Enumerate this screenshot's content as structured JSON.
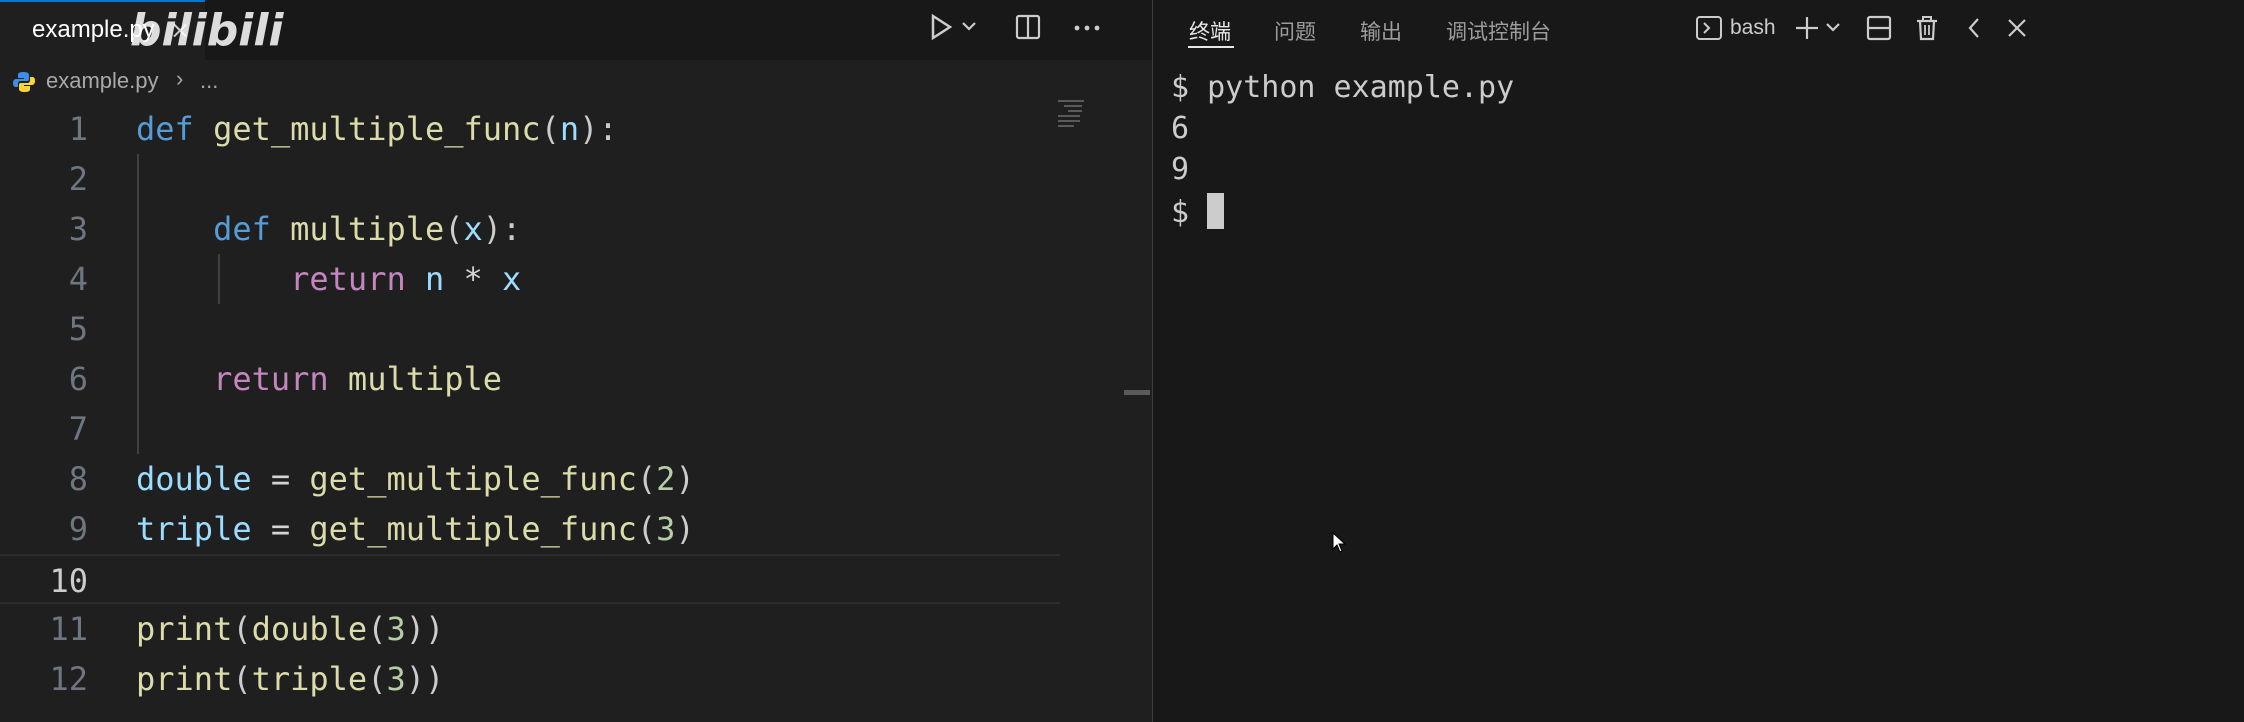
{
  "editor": {
    "tab": {
      "label": "example.py",
      "close": "×"
    },
    "watermark": "bilibili",
    "breadcrumb": {
      "file": "example.py",
      "separator": "›",
      "more": "..."
    },
    "lines": [
      {
        "num": "1",
        "tokens": [
          [
            "kw",
            "def"
          ],
          [
            "pun",
            " "
          ],
          [
            "fn",
            "get_multiple_func"
          ],
          [
            "pun",
            "("
          ],
          [
            "var",
            "n"
          ],
          [
            "pun",
            "):"
          ]
        ]
      },
      {
        "num": "2",
        "tokens": []
      },
      {
        "num": "3",
        "tokens": [
          [
            "pun",
            "    "
          ],
          [
            "kw",
            "def"
          ],
          [
            "pun",
            " "
          ],
          [
            "fn",
            "multiple"
          ],
          [
            "pun",
            "("
          ],
          [
            "var",
            "x"
          ],
          [
            "pun",
            "):"
          ]
        ]
      },
      {
        "num": "4",
        "tokens": [
          [
            "pun",
            "        "
          ],
          [
            "kw2",
            "return"
          ],
          [
            "pun",
            " "
          ],
          [
            "var",
            "n"
          ],
          [
            "op",
            " * "
          ],
          [
            "var",
            "x"
          ]
        ]
      },
      {
        "num": "5",
        "tokens": []
      },
      {
        "num": "6",
        "tokens": [
          [
            "pun",
            "    "
          ],
          [
            "kw2",
            "return"
          ],
          [
            "pun",
            " "
          ],
          [
            "fn",
            "multiple"
          ]
        ]
      },
      {
        "num": "7",
        "tokens": []
      },
      {
        "num": "8",
        "tokens": [
          [
            "var",
            "double"
          ],
          [
            "op",
            " = "
          ],
          [
            "fn",
            "get_multiple_func"
          ],
          [
            "pun",
            "("
          ],
          [
            "num",
            "2"
          ],
          [
            "pun",
            ")"
          ]
        ]
      },
      {
        "num": "9",
        "tokens": [
          [
            "var",
            "triple"
          ],
          [
            "op",
            " = "
          ],
          [
            "fn",
            "get_multiple_func"
          ],
          [
            "pun",
            "("
          ],
          [
            "num",
            "3"
          ],
          [
            "pun",
            ")"
          ]
        ]
      },
      {
        "num": "10",
        "tokens": [],
        "current": true
      },
      {
        "num": "11",
        "tokens": [
          [
            "fn",
            "print"
          ],
          [
            "pun",
            "("
          ],
          [
            "fn",
            "double"
          ],
          [
            "pun",
            "("
          ],
          [
            "num",
            "3"
          ],
          [
            "pun",
            "))"
          ]
        ]
      },
      {
        "num": "12",
        "tokens": [
          [
            "fn",
            "print"
          ],
          [
            "pun",
            "("
          ],
          [
            "fn",
            "triple"
          ],
          [
            "pun",
            "("
          ],
          [
            "num",
            "3"
          ],
          [
            "pun",
            "))"
          ]
        ]
      }
    ]
  },
  "panel": {
    "tabs": [
      {
        "label": "终端",
        "active": true
      },
      {
        "label": "问题",
        "active": false
      },
      {
        "label": "输出",
        "active": false
      },
      {
        "label": "调试控制台",
        "active": false
      }
    ],
    "shell_label": "bash"
  },
  "terminal": {
    "lines": [
      "$ python example.py",
      "6",
      "9",
      "$ "
    ]
  },
  "colors": {
    "keyword": "#569cd6",
    "control": "#c586c0",
    "function": "#dcdcaa",
    "variable": "#9cdcfe",
    "number": "#b5cea8",
    "accent": "#0078d4"
  }
}
